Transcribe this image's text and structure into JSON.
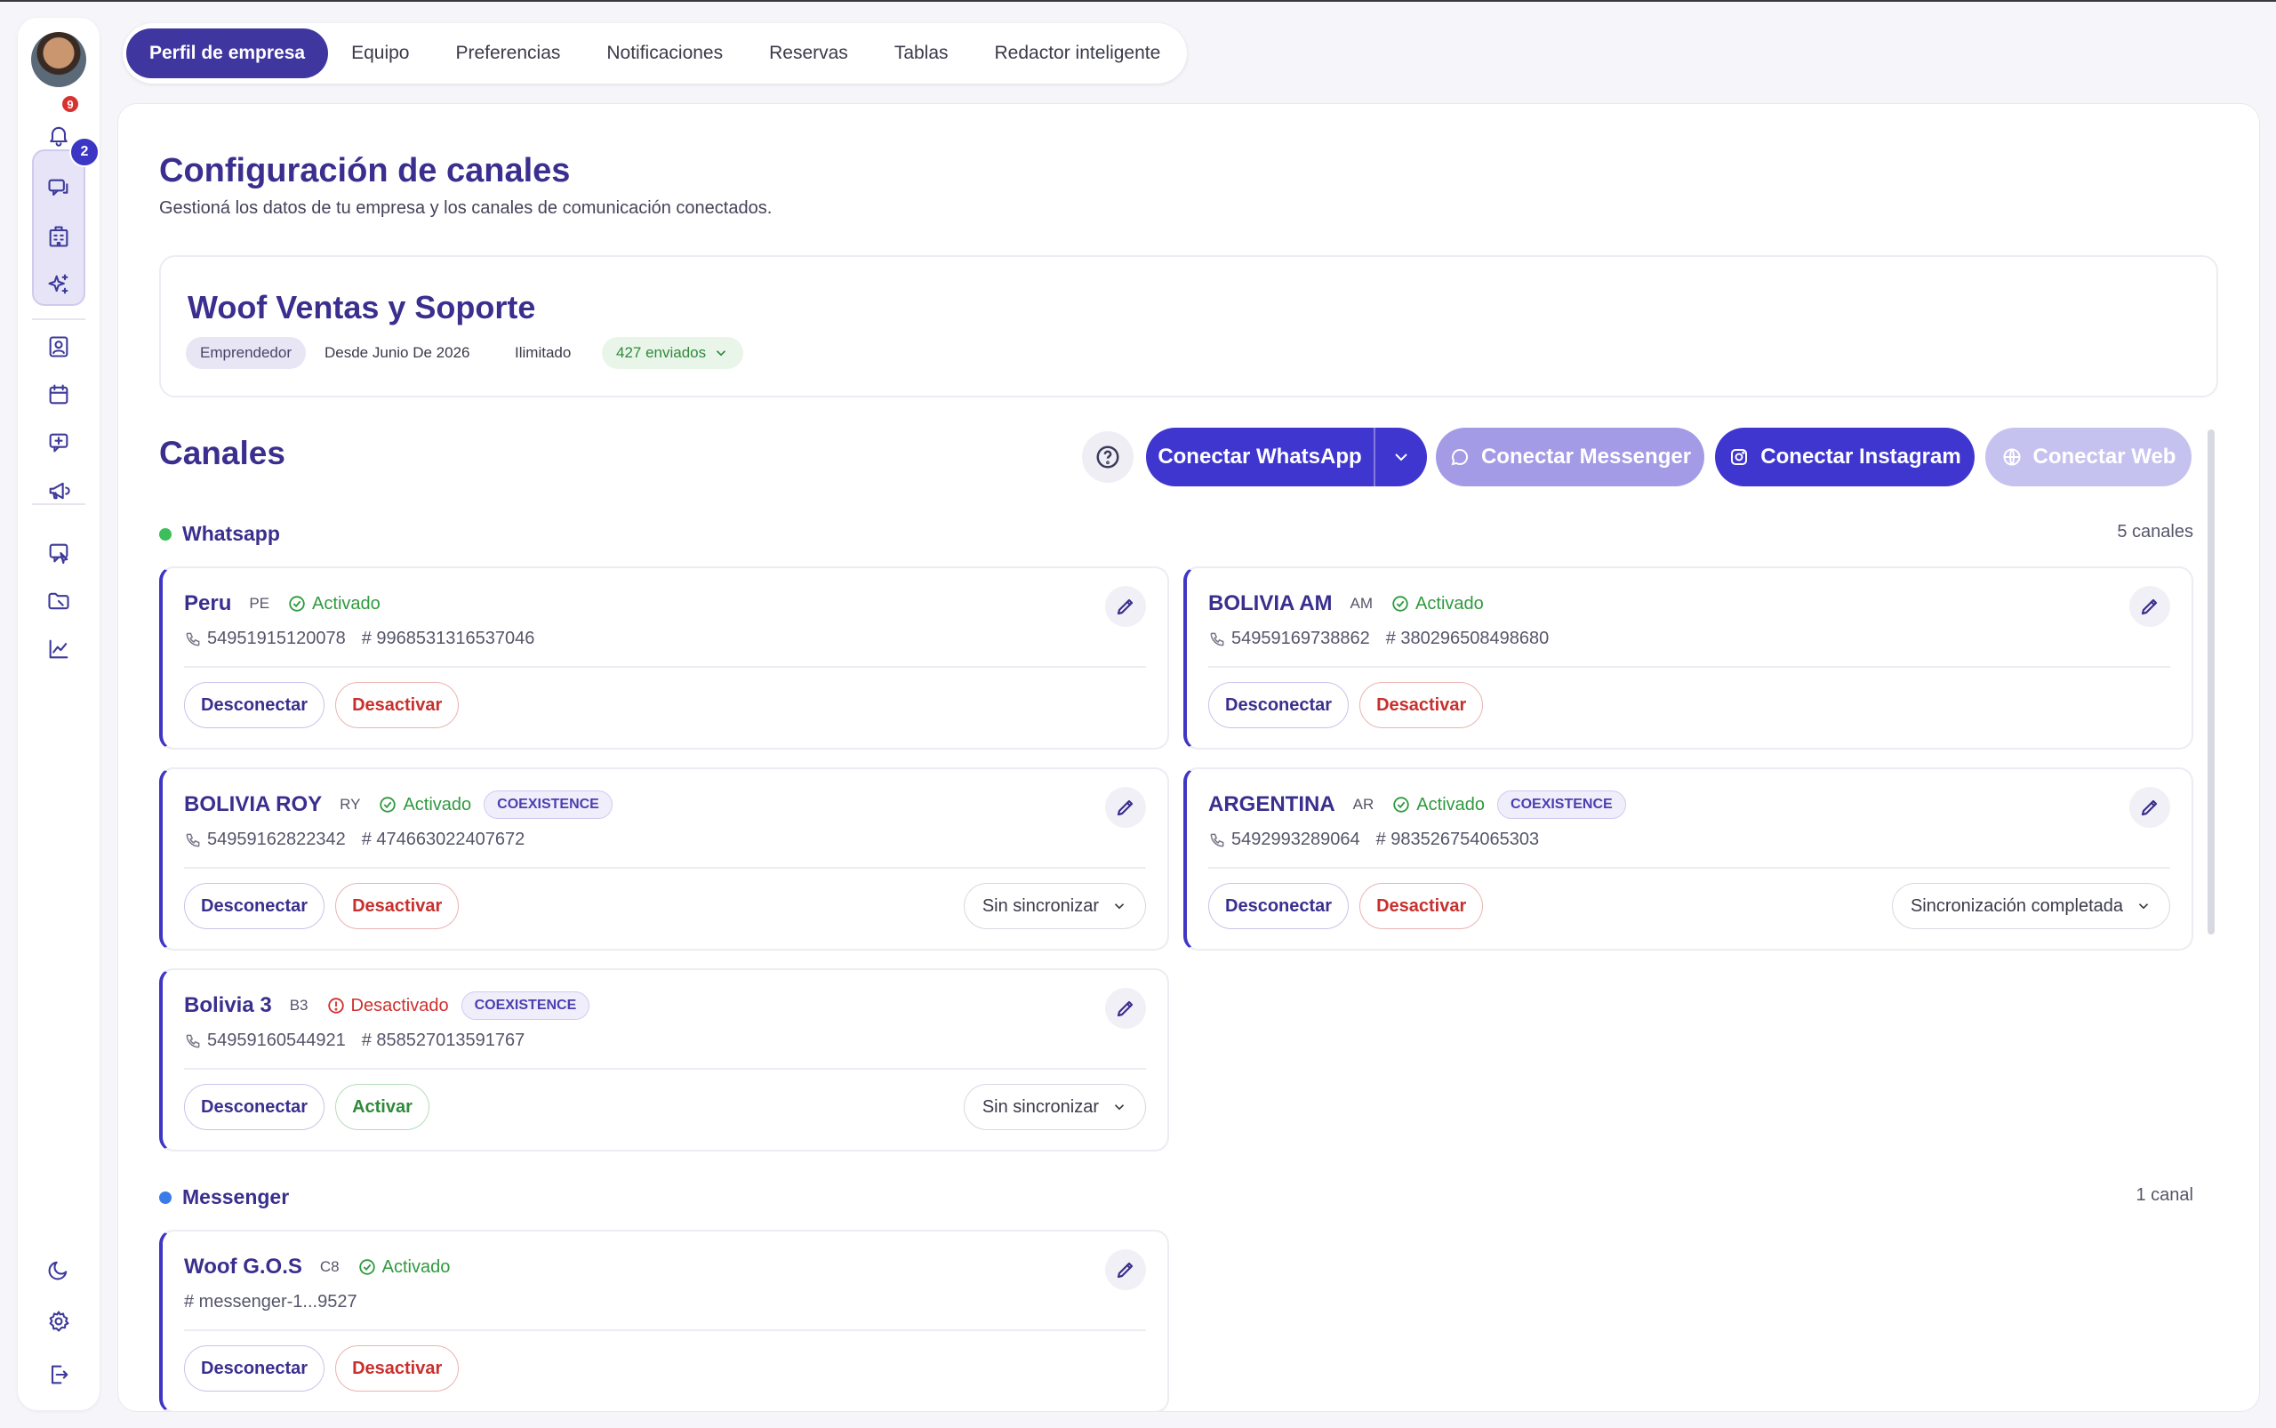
{
  "sidebar": {
    "notification_badge": "9",
    "chat_badge": "2",
    "icons": [
      "bell-icon",
      "chat-icon",
      "building-icon",
      "sparkles-icon",
      "contact-icon",
      "calendar-icon",
      "message-plus-icon",
      "megaphone-icon",
      "message-cursor-icon",
      "folder-icon",
      "chart-icon",
      "moon-icon",
      "gear-icon",
      "logout-icon"
    ]
  },
  "tabs": [
    "Perfil de empresa",
    "Equipo",
    "Preferencias",
    "Notificaciones",
    "Reservas",
    "Tablas",
    "Redactor inteligente"
  ],
  "active_tab": "Perfil de empresa",
  "page": {
    "title": "Configuración de canales",
    "subtitle": "Gestioná los datos de tu empresa y los canales de comunicación conectados."
  },
  "company": {
    "name": "Woof Ventas y Soporte",
    "plan": "Emprendedor",
    "since": "Desde Junio De 2026",
    "limit": "Ilimitado",
    "sent": "427 enviados"
  },
  "channels_section": {
    "title": "Canales",
    "buttons": {
      "whatsapp": "Conectar WhatsApp",
      "messenger": "Conectar Messenger",
      "instagram": "Conectar Instagram",
      "web": "Conectar Web"
    }
  },
  "groups": {
    "whatsapp": {
      "label": "Whatsapp",
      "count": "5 canales",
      "dot_color": "#3cbf5a",
      "channels": [
        {
          "name": "Peru",
          "code": "PE",
          "status": "Activado",
          "phone": "54951915120078",
          "id": "# 9968531316537046",
          "disconnect": "Desconectar",
          "toggle": "Desactivar"
        },
        {
          "name": "BOLIVIA AM",
          "code": "AM",
          "status": "Activado",
          "phone": "54959169738862",
          "id": "# 380296508498680",
          "disconnect": "Desconectar",
          "toggle": "Desactivar"
        },
        {
          "name": "BOLIVIA ROY",
          "code": "RY",
          "status": "Activado",
          "tag": "COEXISTENCE",
          "phone": "54959162822342",
          "id": "# 474663022407672",
          "disconnect": "Desconectar",
          "toggle": "Desactivar",
          "sync": "Sin sincronizar"
        },
        {
          "name": "ARGENTINA",
          "code": "AR",
          "status": "Activado",
          "tag": "COEXISTENCE",
          "phone": "5492993289064",
          "id": "# 983526754065303",
          "disconnect": "Desconectar",
          "toggle": "Desactivar",
          "sync": "Sincronización completada"
        },
        {
          "name": "Bolivia 3",
          "code": "B3",
          "status": "Desactivado",
          "tag": "COEXISTENCE",
          "phone": "54959160544921",
          "id": "# 858527013591767",
          "disconnect": "Desconectar",
          "toggle": "Activar",
          "sync": "Sin sincronizar"
        }
      ]
    },
    "messenger": {
      "label": "Messenger",
      "count": "1 canal",
      "dot_color": "#3b7be8",
      "channels": [
        {
          "name": "Woof G.O.S",
          "code": "C8",
          "status": "Activado",
          "id": "# messenger-1...9527",
          "disconnect": "Desconectar",
          "toggle": "Desactivar"
        }
      ]
    }
  },
  "colors": {
    "primary": "#3f36d0",
    "heading": "#3a2f8e",
    "active_green": "#2f9a3e",
    "inactive_red": "#d0302d"
  }
}
